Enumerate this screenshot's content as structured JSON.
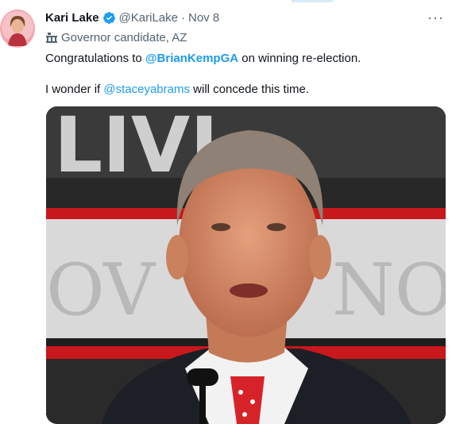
{
  "tweet": {
    "display_name": "Kari Lake",
    "handle": "@KariLake",
    "separator": "·",
    "date": "Nov 8",
    "affiliation": "Governor candidate, AZ",
    "more_label": "···",
    "line1": {
      "before": "Congratulations to ",
      "mention": "@BrianKempGA",
      "after": " on winning re-election."
    },
    "line2": {
      "before": "I wonder if ",
      "mention": "@staceyabrams",
      "after": " will concede this time."
    },
    "backdrop_letters_top": "LIVI",
    "backdrop_letters_bottom": "OV",
    "backdrop_letters_right": "NO"
  },
  "colors": {
    "accent": "#1d9bf0",
    "secondary_text": "#536471",
    "primary_text": "#0f1419"
  },
  "icons": {
    "verified": "verified-badge-icon",
    "affiliation": "government-building-icon",
    "more": "more-options-icon"
  }
}
